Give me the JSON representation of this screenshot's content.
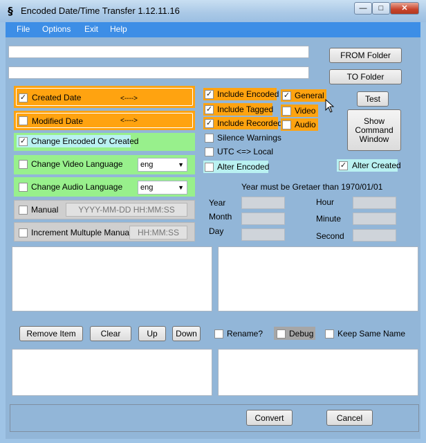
{
  "window": {
    "app_icon_glyph": "§",
    "title": "Encoded Date/Time Transfer 1.12.11.16",
    "controls": {
      "minimize": "—",
      "maximize": "□",
      "close": "✕"
    }
  },
  "menu": [
    "File",
    "Options",
    "Exit",
    "Help"
  ],
  "paths": {
    "path1": "",
    "path2": ""
  },
  "buttons": {
    "from_folder": "FROM Folder",
    "to_folder": "TO Folder",
    "test": "Test",
    "show_command": "Show Command Window",
    "remove_item": "Remove Item",
    "clear": "Clear",
    "up": "Up",
    "down": "Down",
    "convert": "Convert",
    "cancel": "Cancel"
  },
  "left_options": {
    "created_date": {
      "label": "Created Date",
      "arrow": "<---->",
      "checked": true
    },
    "modified_date": {
      "label": "Modified Date",
      "arrow": "<---->",
      "checked": false
    },
    "change_encoded": {
      "label": "Change Encoded Or Created",
      "checked": true
    },
    "video_language": {
      "label": "Change Video Language",
      "value": "eng",
      "checked": false
    },
    "audio_language": {
      "label": "Change Audio Language",
      "value": "eng",
      "checked": false
    },
    "manual": {
      "label": "Manual",
      "placeholder": "YYYY-MM-DD HH:MM:SS",
      "checked": false
    },
    "increment": {
      "label": "Increment Multuple Manual",
      "placeholder": "HH:MM:SS",
      "checked": false
    }
  },
  "middle_options": {
    "include_encoded": {
      "label": "Include Encoded",
      "checked": true
    },
    "include_tagged": {
      "label": "Include Tagged",
      "checked": true
    },
    "include_recorded": {
      "label": "Include Recorded",
      "checked": true
    },
    "silence_warnings": {
      "label": "Silence Warnings",
      "checked": false
    },
    "utc_local": {
      "label": "UTC  <=> Local",
      "checked": false
    },
    "alter_encoded": {
      "label": "Alter Encoded",
      "checked": false
    }
  },
  "type_options": {
    "general": {
      "label": "General",
      "checked": true
    },
    "video": {
      "label": "Video",
      "checked": false
    },
    "audio": {
      "label": "Audio",
      "checked": false
    }
  },
  "alter_created": {
    "label": "Alter Created",
    "checked": true
  },
  "date_section": {
    "notice": "Year must be Gretaer than 1970/01/01",
    "year": "Year",
    "month": "Month",
    "day": "Day",
    "hour": "Hour",
    "minute": "Minute",
    "second": "Second"
  },
  "bottom_options": {
    "rename": {
      "label": "Rename?",
      "checked": false
    },
    "debug": {
      "label": "Debug",
      "checked": false
    },
    "keep_same_name": {
      "label": "Keep Same Name",
      "checked": false
    }
  },
  "colors": {
    "orange": "#ffa310",
    "green": "#98f08c",
    "menu_blue": "#3d8ee6",
    "cyan": "#b9f1f1"
  }
}
